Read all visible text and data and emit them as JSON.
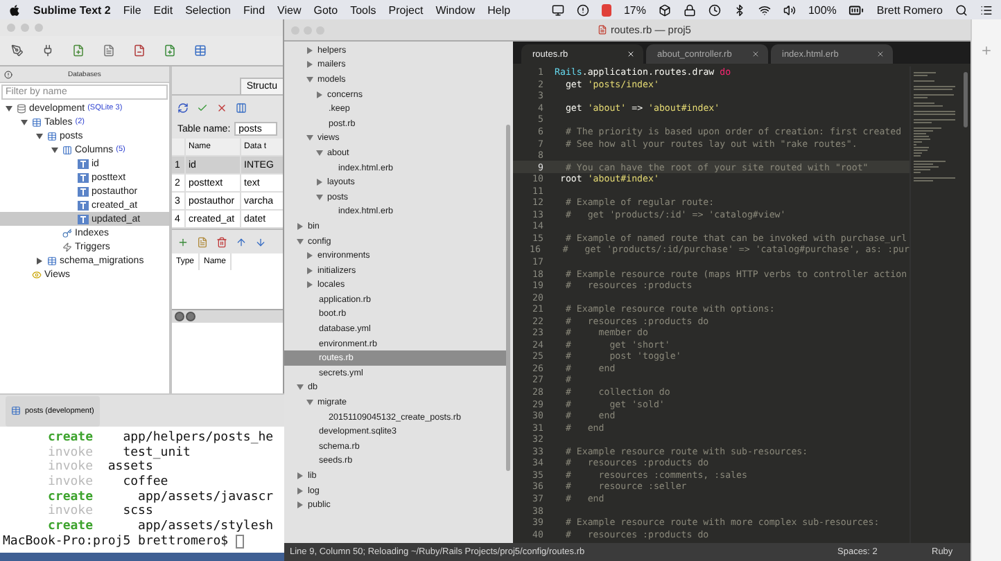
{
  "menu_bar": {
    "app": "Sublime Text 2",
    "menus": [
      "File",
      "Edit",
      "Selection",
      "Find",
      "View",
      "Goto",
      "Tools",
      "Project",
      "Window",
      "Help"
    ],
    "cpu_reading": "17%",
    "battery_reading": "100%",
    "user": "Brett Romero"
  },
  "sqlite_window": {
    "panel_title": "Databases",
    "filter": {
      "placeholder": "Filter by name"
    },
    "tree": [
      {
        "label": "development",
        "note": "(SQLite 3)",
        "kind": "database",
        "expanded": true,
        "selected": false,
        "children": [
          {
            "label": "Tables",
            "note": "(2)",
            "kind": "tables",
            "expanded": true,
            "selected": false,
            "children": [
              {
                "label": "posts",
                "kind": "table",
                "expanded": true,
                "selected": false,
                "children": [
                  {
                    "label": "Columns",
                    "note": "(5)",
                    "kind": "columns",
                    "expanded": true,
                    "selected": false,
                    "children": [
                      {
                        "label": "id",
                        "kind": "column",
                        "selected": false
                      },
                      {
                        "label": "posttext",
                        "kind": "column",
                        "selected": false
                      },
                      {
                        "label": "postauthor",
                        "kind": "column",
                        "selected": false
                      },
                      {
                        "label": "created_at",
                        "kind": "column",
                        "selected": false
                      },
                      {
                        "label": "updated_at",
                        "kind": "column",
                        "selected": true
                      }
                    ]
                  },
                  {
                    "label": "Indexes",
                    "kind": "indexes",
                    "selected": false
                  },
                  {
                    "label": "Triggers",
                    "kind": "triggers",
                    "selected": false
                  }
                ]
              },
              {
                "label": "schema_migrations",
                "kind": "table",
                "expanded": false,
                "selected": false
              }
            ]
          },
          {
            "label": "Views",
            "kind": "views",
            "selected": false
          }
        ]
      }
    ],
    "structure": {
      "tab": "Structu",
      "table_name_label": "Table name:",
      "table_name": "posts",
      "columns": [
        "Name",
        "Data t"
      ],
      "rows": [
        {
          "index": "1",
          "name": "id",
          "type": "INTEG",
          "selected": true
        },
        {
          "index": "2",
          "name": "posttext",
          "type": "text",
          "selected": false
        },
        {
          "index": "3",
          "name": "postauthor",
          "type": "varcha",
          "selected": false
        },
        {
          "index": "4",
          "name": "created_at",
          "type": "datet",
          "selected": false
        }
      ],
      "index_columns": [
        "Type",
        "Name"
      ]
    },
    "taskbar_item": "posts (development)"
  },
  "terminal": {
    "lines": [
      {
        "kind": "create",
        "action": "create",
        "text": "    app/helpers/posts_he"
      },
      {
        "kind": "invoke",
        "action": "invoke",
        "text": "    test_unit"
      },
      {
        "kind": "invoke",
        "action": "invoke",
        "text": "  assets"
      },
      {
        "kind": "invoke",
        "action": "invoke",
        "text": "    coffee"
      },
      {
        "kind": "create",
        "action": "create",
        "text": "      app/assets/javascr"
      },
      {
        "kind": "invoke",
        "action": "invoke",
        "text": "    scss"
      },
      {
        "kind": "create",
        "action": "create",
        "text": "      app/assets/stylesh"
      },
      {
        "kind": "prompt",
        "text": "MacBook-Pro:proj5 brettromero$"
      }
    ]
  },
  "sublime": {
    "title": "routes.rb — proj5",
    "sidebar": {
      "continued_items": [
        {
          "label": "helpers",
          "kind": "folder",
          "expanded": false,
          "selected": false
        },
        {
          "label": "mailers",
          "kind": "folder",
          "expanded": false,
          "selected": false
        },
        {
          "label": "models",
          "kind": "folder",
          "expanded": true,
          "selected": false,
          "children": [
            {
              "label": "concerns",
              "kind": "folder",
              "expanded": false,
              "selected": false
            },
            {
              "label": ".keep",
              "kind": "file",
              "selected": false
            },
            {
              "label": "post.rb",
              "kind": "file",
              "selected": false
            }
          ]
        },
        {
          "label": "views",
          "kind": "folder",
          "expanded": true,
          "selected": false,
          "children": [
            {
              "label": "about",
              "kind": "folder",
              "expanded": true,
              "selected": false,
              "children": [
                {
                  "label": "index.html.erb",
                  "kind": "file",
                  "selected": false
                }
              ]
            },
            {
              "label": "layouts",
              "kind": "folder",
              "expanded": false,
              "selected": false
            },
            {
              "label": "posts",
              "kind": "folder",
              "expanded": true,
              "selected": false,
              "children": [
                {
                  "label": "index.html.erb",
                  "kind": "file",
                  "selected": false
                }
              ]
            }
          ]
        }
      ],
      "items": [
        {
          "label": "bin",
          "kind": "folder",
          "expanded": false,
          "selected": false
        },
        {
          "label": "config",
          "kind": "folder",
          "expanded": true,
          "selected": false,
          "children": [
            {
              "label": "environments",
              "kind": "folder",
              "expanded": false,
              "selected": false
            },
            {
              "label": "initializers",
              "kind": "folder",
              "expanded": false,
              "selected": false
            },
            {
              "label": "locales",
              "kind": "folder",
              "expanded": false,
              "selected": false
            },
            {
              "label": "application.rb",
              "kind": "file",
              "selected": false
            },
            {
              "label": "boot.rb",
              "kind": "file",
              "selected": false
            },
            {
              "label": "database.yml",
              "kind": "file",
              "selected": false
            },
            {
              "label": "environment.rb",
              "kind": "file",
              "selected": false
            },
            {
              "label": "routes.rb",
              "kind": "file",
              "selected": true
            },
            {
              "label": "secrets.yml",
              "kind": "file",
              "selected": false
            }
          ]
        },
        {
          "label": "db",
          "kind": "folder",
          "expanded": true,
          "selected": false,
          "children": [
            {
              "label": "migrate",
              "kind": "folder",
              "expanded": true,
              "selected": false,
              "children": [
                {
                  "label": "20151109045132_create_posts.rb",
                  "kind": "file",
                  "selected": false
                }
              ]
            },
            {
              "label": "development.sqlite3",
              "kind": "file",
              "selected": false
            },
            {
              "label": "schema.rb",
              "kind": "file",
              "selected": false
            },
            {
              "label": "seeds.rb",
              "kind": "file",
              "selected": false
            }
          ]
        },
        {
          "label": "lib",
          "kind": "folder",
          "expanded": false,
          "selected": false
        },
        {
          "label": "log",
          "kind": "folder",
          "expanded": false,
          "selected": false
        },
        {
          "label": "public",
          "kind": "folder",
          "expanded": false,
          "selected": false
        }
      ]
    },
    "tabs": [
      {
        "label": "routes.rb",
        "selected": true
      },
      {
        "label": "about_controller.rb",
        "selected": false
      },
      {
        "label": "index.html.erb",
        "selected": false
      }
    ],
    "lines": [
      {
        "number": "1",
        "current": false,
        "segments": [
          {
            "kind": "constant",
            "text": "Rails"
          },
          {
            "kind": "plain",
            "text": ".application.routes.draw "
          },
          {
            "kind": "keyword",
            "text": "do"
          }
        ]
      },
      {
        "number": "2",
        "current": false,
        "segments": [
          {
            "kind": "plain",
            "text": "  get "
          },
          {
            "kind": "string",
            "text": "'posts/index'"
          }
        ]
      },
      {
        "number": "3",
        "current": false
      },
      {
        "number": "4",
        "current": false,
        "segments": [
          {
            "kind": "plain",
            "text": "  get "
          },
          {
            "kind": "string",
            "text": "'about'"
          },
          {
            "kind": "plain",
            "text": " => "
          },
          {
            "kind": "string",
            "text": "'about#index'"
          }
        ]
      },
      {
        "number": "5",
        "current": false
      },
      {
        "number": "6",
        "current": false,
        "segments": [
          {
            "kind": "comment",
            "text": "  # The priority is based upon order of creation: first created"
          }
        ]
      },
      {
        "number": "7",
        "current": false,
        "segments": [
          {
            "kind": "comment",
            "text": "  # See how all your routes lay out with \"rake routes\"."
          }
        ]
      },
      {
        "number": "8",
        "current": false
      },
      {
        "number": "9",
        "current": true,
        "segments": [
          {
            "kind": "comment",
            "text": "  # You can have the root of your site routed with \"root\""
          }
        ]
      },
      {
        "number": "10",
        "current": false,
        "segments": [
          {
            "kind": "plain",
            "text": " root "
          },
          {
            "kind": "string",
            "text": "'about#index'"
          }
        ]
      },
      {
        "number": "11",
        "current": false
      },
      {
        "number": "12",
        "current": false,
        "segments": [
          {
            "kind": "comment",
            "text": "  # Example of regular route:"
          }
        ]
      },
      {
        "number": "13",
        "current": false,
        "segments": [
          {
            "kind": "comment",
            "text": "  #   get 'products/:id' => 'catalog#view'"
          }
        ]
      },
      {
        "number": "14",
        "current": false
      },
      {
        "number": "15",
        "current": false,
        "segments": [
          {
            "kind": "comment",
            "text": "  # Example of named route that can be invoked with purchase_url"
          }
        ]
      },
      {
        "number": "16",
        "current": false,
        "segments": [
          {
            "kind": "comment",
            "text": "  #   get 'products/:id/purchase' => 'catalog#purchase', as: :pur"
          }
        ]
      },
      {
        "number": "17",
        "current": false
      },
      {
        "number": "18",
        "current": false,
        "segments": [
          {
            "kind": "comment",
            "text": "  # Example resource route (maps HTTP verbs to controller action"
          }
        ]
      },
      {
        "number": "19",
        "current": false,
        "segments": [
          {
            "kind": "comment",
            "text": "  #   resources :products"
          }
        ]
      },
      {
        "number": "20",
        "current": false
      },
      {
        "number": "21",
        "current": false,
        "segments": [
          {
            "kind": "comment",
            "text": "  # Example resource route with options:"
          }
        ]
      },
      {
        "number": "22",
        "current": false,
        "segments": [
          {
            "kind": "comment",
            "text": "  #   resources :products do"
          }
        ]
      },
      {
        "number": "23",
        "current": false,
        "segments": [
          {
            "kind": "comment",
            "text": "  #     member do"
          }
        ]
      },
      {
        "number": "24",
        "current": false,
        "segments": [
          {
            "kind": "comment",
            "text": "  #       get 'short'"
          }
        ]
      },
      {
        "number": "25",
        "current": false,
        "segments": [
          {
            "kind": "comment",
            "text": "  #       post 'toggle'"
          }
        ]
      },
      {
        "number": "26",
        "current": false,
        "segments": [
          {
            "kind": "comment",
            "text": "  #     end"
          }
        ]
      },
      {
        "number": "27",
        "current": false,
        "segments": [
          {
            "kind": "comment",
            "text": "  #"
          }
        ]
      },
      {
        "number": "28",
        "current": false,
        "segments": [
          {
            "kind": "comment",
            "text": "  #     collection do"
          }
        ]
      },
      {
        "number": "29",
        "current": false,
        "segments": [
          {
            "kind": "comment",
            "text": "  #       get 'sold'"
          }
        ]
      },
      {
        "number": "30",
        "current": false,
        "segments": [
          {
            "kind": "comment",
            "text": "  #     end"
          }
        ]
      },
      {
        "number": "31",
        "current": false,
        "segments": [
          {
            "kind": "comment",
            "text": "  #   end"
          }
        ]
      },
      {
        "number": "32",
        "current": false
      },
      {
        "number": "33",
        "current": false,
        "segments": [
          {
            "kind": "comment",
            "text": "  # Example resource route with sub-resources:"
          }
        ]
      },
      {
        "number": "34",
        "current": false,
        "segments": [
          {
            "kind": "comment",
            "text": "  #   resources :products do"
          }
        ]
      },
      {
        "number": "35",
        "current": false,
        "segments": [
          {
            "kind": "comment",
            "text": "  #     resources :comments, :sales"
          }
        ]
      },
      {
        "number": "36",
        "current": false,
        "segments": [
          {
            "kind": "comment",
            "text": "  #     resource :seller"
          }
        ]
      },
      {
        "number": "37",
        "current": false,
        "segments": [
          {
            "kind": "comment",
            "text": "  #   end"
          }
        ]
      },
      {
        "number": "38",
        "current": false
      },
      {
        "number": "39",
        "current": false,
        "segments": [
          {
            "kind": "comment",
            "text": "  # Example resource route with more complex sub-resources:"
          }
        ]
      },
      {
        "number": "40",
        "current": false,
        "segments": [
          {
            "kind": "comment",
            "text": "  #   resources :products do"
          }
        ]
      }
    ],
    "status": {
      "message": "Line 9, Column 50; Reloading ~/Ruby/Rails Projects/proj5/config/routes.rb",
      "indentation": "Spaces: 2",
      "syntax": "Ruby"
    }
  }
}
